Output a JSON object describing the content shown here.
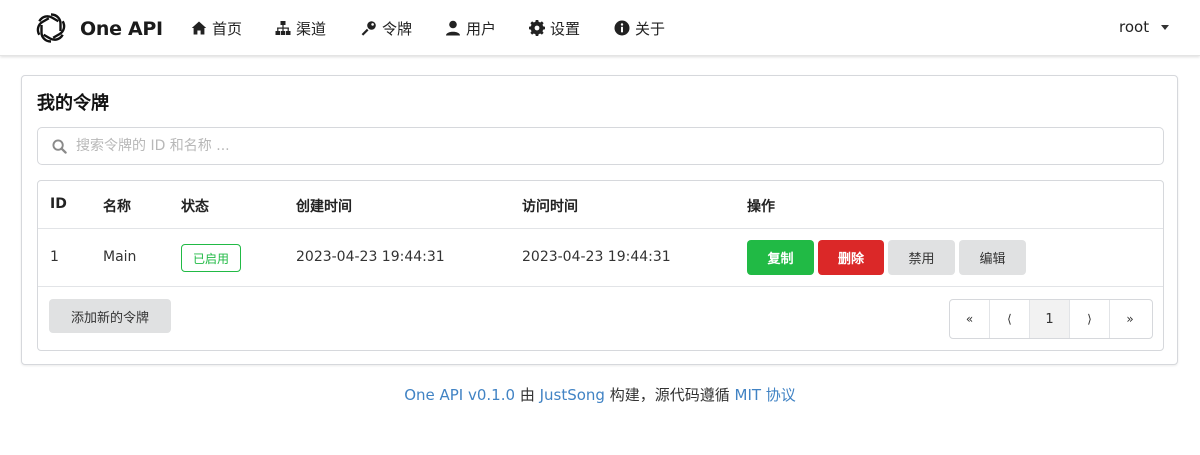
{
  "header": {
    "brand": "One API",
    "nav": [
      {
        "label": "首页",
        "icon": "home-icon"
      },
      {
        "label": "渠道",
        "icon": "sitemap-icon"
      },
      {
        "label": "令牌",
        "icon": "key-icon"
      },
      {
        "label": "用户",
        "icon": "user-icon"
      },
      {
        "label": "设置",
        "icon": "gear-icon"
      },
      {
        "label": "关于",
        "icon": "info-icon"
      }
    ],
    "user": "root"
  },
  "page": {
    "title": "我的令牌",
    "search_placeholder": "搜索令牌的 ID 和名称 ..."
  },
  "table": {
    "columns": [
      "ID",
      "名称",
      "状态",
      "创建时间",
      "访问时间",
      "操作"
    ],
    "rows": [
      {
        "id": "1",
        "name": "Main",
        "status": "已启用",
        "created": "2023-04-23 19:44:31",
        "accessed": "2023-04-23 19:44:31",
        "actions": {
          "copy": "复制",
          "delete": "删除",
          "disable": "禁用",
          "edit": "编辑"
        }
      }
    ]
  },
  "add_button": "添加新的令牌",
  "pagination": {
    "first": "«",
    "prev": "⟨",
    "current": "1",
    "next": "⟩",
    "last": "»"
  },
  "footer": {
    "app": "One API v0.1.0",
    "by": " 由 ",
    "author": "JustSong",
    "built": " 构建，源代码遵循 ",
    "license": "MIT 协议"
  },
  "colors": {
    "success": "#21ba45",
    "danger": "#db2828",
    "neutral_button": "#e0e1e2",
    "link": "#4183c4"
  }
}
